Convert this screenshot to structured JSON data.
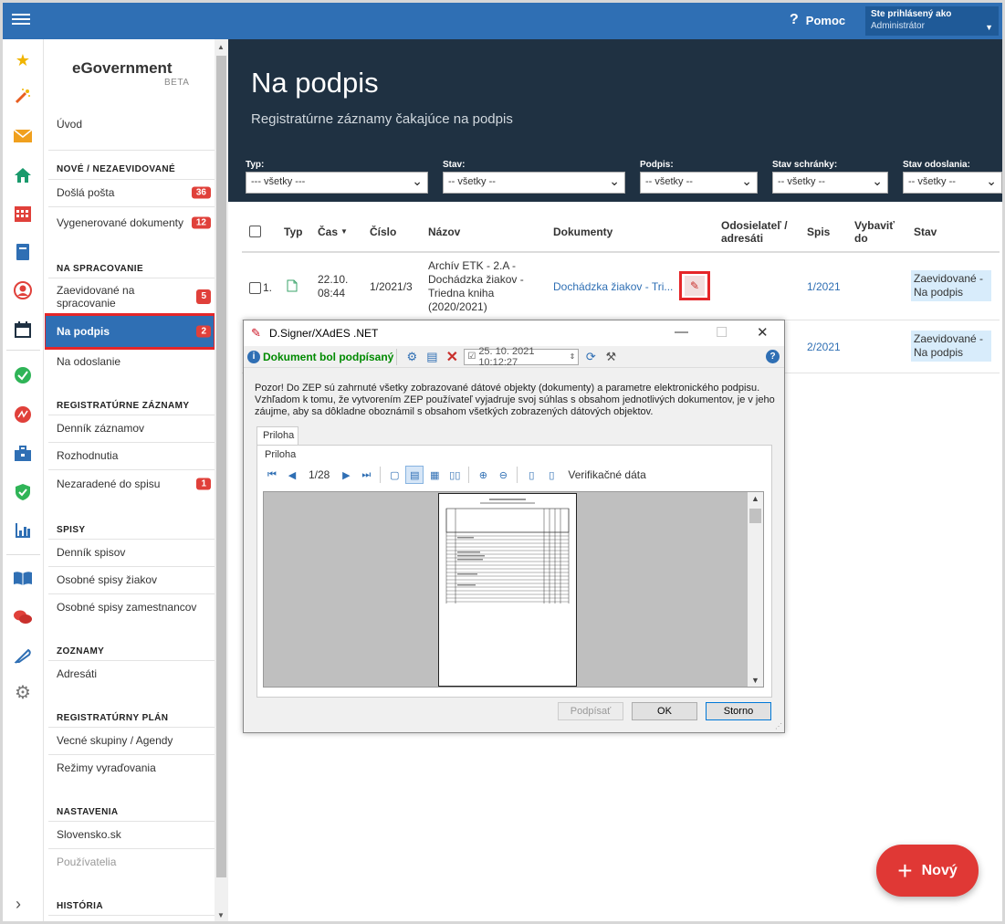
{
  "topbar": {
    "help_label": "Pomoc",
    "user_line1": "Ste prihlásený ako",
    "user_line2": "Administrátor"
  },
  "brand": {
    "name": "eGovernment",
    "beta": "BETA"
  },
  "nav": {
    "home": "Úvod",
    "sect_new": "NOVÉ / NEZAEVIDOVANÉ",
    "dosla_posta": "Došlá pošta",
    "dosla_posta_badge": "36",
    "vygenerovane": "Vygenerované dokumenty",
    "vygenerovane_badge": "12",
    "sect_processing": "NA SPRACOVANIE",
    "zaevidovane": "Zaevidované na spracovanie",
    "zaevidovane_badge": "5",
    "na_podpis": "Na podpis",
    "na_podpis_badge": "2",
    "na_odoslanie": "Na odoslanie",
    "sect_records": "REGISTRATÚRNE ZÁZNAMY",
    "dennik_zaznamov": "Denník záznamov",
    "rozhodnutia": "Rozhodnutia",
    "nezaradene": "Nezaradené do spisu",
    "nezaradene_badge": "1",
    "sect_spisy": "SPISY",
    "dennik_spisov": "Denník spisov",
    "osobne_ziakov": "Osobné spisy žiakov",
    "osobne_zamestnancov": "Osobné spisy zamestnancov",
    "sect_zoznamy": "ZOZNAMY",
    "adresati": "Adresáti",
    "sect_plan": "REGISTRATÚRNY PLÁN",
    "vecne_skupiny": "Vecné skupiny / Agendy",
    "rezimy": "Režimy vyraďovania",
    "sect_settings": "NASTAVENIA",
    "slovensko": "Slovensko.sk",
    "pouzivatelia": "Používatelia",
    "sect_history": "HISTÓRIA"
  },
  "page": {
    "title": "Na podpis",
    "subtitle": "Registratúrne záznamy čakajúce na podpis"
  },
  "filters": {
    "typ_label": "Typ:",
    "typ_value": "--- všetky ---",
    "stav_label": "Stav:",
    "stav_value": "-- všetky --",
    "podpis_label": "Podpis:",
    "podpis_value": "-- všetky --",
    "schranka_label": "Stav schránky:",
    "schranka_value": "-- všetky --",
    "odoslania_label": "Stav odoslania:",
    "odoslania_value": "-- všetky --"
  },
  "table": {
    "headers": {
      "typ": "Typ",
      "cas": "Čas",
      "cislo": "Číslo",
      "nazov": "Názov",
      "dokumenty": "Dokumenty",
      "odosielatel": "Odosielateľ / adresáti",
      "spis": "Spis",
      "vybavit": "Vybaviť do",
      "stav": "Stav"
    },
    "rows": [
      {
        "index": "1.",
        "cas_date": "22.10.",
        "cas_time": "08:44",
        "cislo": "1/2021/3",
        "nazov": "Archív ETK - 2.A - Dochádzka žiakov - Triedna kniha (2020/2021)",
        "dokument": "Dochádzka žiakov - Tri...",
        "spis": "1/2021",
        "stav": "Zaevidované - Na podpis"
      },
      {
        "spis": "2/2021",
        "stav": "Zaevidované - Na podpis"
      }
    ]
  },
  "dialog": {
    "title": "D.Signer/XAdES .NET",
    "signed_status": "Dokument bol podpísaný",
    "datetime": "25. 10. 2021 10:12:27",
    "warning": "Pozor! Do ZEP sú zahrnuté všetky zobrazované dátové objekty (dokumenty) a parametre elektronického podpisu. Vzhľadom k tomu, že vytvorením ZEP používateľ vyjadruje svoj súhlas s obsahom jednotlivých dokumentov, je v jeho záujme, aby sa dôkladne oboznámil s obsahom všetkých zobrazených dátových objektov.",
    "tab_label": "Priloha",
    "panel_label": "Priloha",
    "page_indicator": "1/28",
    "verif_label": "Verifikačné dáta",
    "btn_sign": "Podpísať",
    "btn_ok": "OK",
    "btn_cancel": "Storno"
  },
  "fab": {
    "label": "Nový"
  }
}
